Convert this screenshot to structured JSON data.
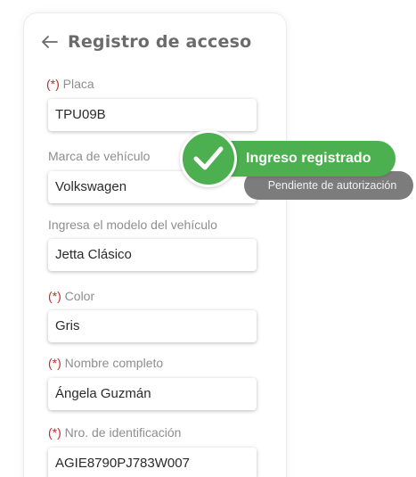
{
  "header": {
    "title": "Registro de acceso"
  },
  "form": {
    "required_marker": "(*)",
    "fields": [
      {
        "label": "Placa",
        "required": true,
        "value": "TPU09B"
      },
      {
        "label": "Marca de vehículo",
        "required": false,
        "value": "Volkswagen"
      },
      {
        "label": "Ingresa el modelo del vehículo",
        "required": false,
        "value": "Jetta Clásico"
      },
      {
        "label": "Color",
        "required": true,
        "value": "Gris"
      },
      {
        "label": "Nombre completo",
        "required": true,
        "value": "Ángela Guzmán"
      },
      {
        "label": "Nro. de identificación",
        "required": true,
        "value": "AGIE8790PJ783W007"
      }
    ]
  },
  "toast": {
    "title": "Ingreso registrado",
    "subtitle": "Pendiente de autorización",
    "icon": "check-circle-icon"
  },
  "colors": {
    "success_green": "#4caf50",
    "required_red": "#c42b2b",
    "subtitle_grey": "#7c7c7c"
  }
}
